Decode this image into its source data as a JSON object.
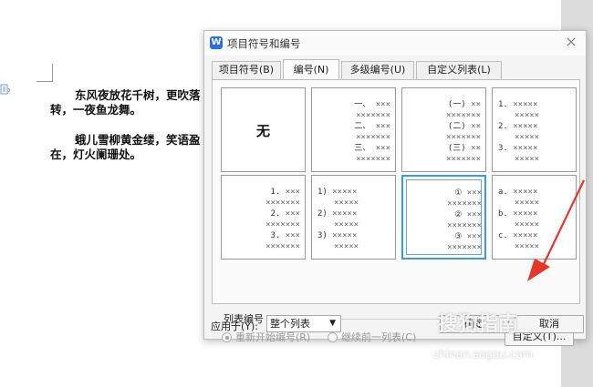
{
  "document": {
    "lines": [
      "东风夜放花千树，更吹落",
      "转，一夜鱼龙舞。",
      "蛾儿雪柳黄金缕，笑语盈",
      "在，灯火阑珊处。"
    ]
  },
  "dialog": {
    "title": "项目符号和编号",
    "tabs": [
      "项目符号(B)",
      "编号(N)",
      "多级编号(U)",
      "自定义列表(L)"
    ],
    "active_tab": "编号(N)",
    "cells": [
      {
        "id": "none",
        "label": "无",
        "rows": []
      },
      {
        "id": "chinese",
        "rows": [
          {
            "num": "一、",
            "text": "×××"
          },
          {
            "num": "",
            "text": "×××××××"
          },
          {
            "num": "二、",
            "text": "×××"
          },
          {
            "num": "",
            "text": "×××××××"
          },
          {
            "num": "三、",
            "text": "×××"
          },
          {
            "num": "",
            "text": "×××××××"
          }
        ]
      },
      {
        "id": "paren-chinese",
        "rows": [
          {
            "num": "(一)",
            "text": "××"
          },
          {
            "num": "",
            "text": "×××××××"
          },
          {
            "num": "(二)",
            "text": "××"
          },
          {
            "num": "",
            "text": "×××××××"
          },
          {
            "num": "(三)",
            "text": "××"
          },
          {
            "num": "",
            "text": "×××××××"
          }
        ]
      },
      {
        "id": "decimal-dot",
        "rows": [
          {
            "num": "1.",
            "text": "×××××"
          },
          {
            "num": "",
            "text": "×××××"
          },
          {
            "num": "2.",
            "text": "×××××"
          },
          {
            "num": "",
            "text": "×××××"
          },
          {
            "num": "3.",
            "text": "×××××"
          },
          {
            "num": "",
            "text": "×××××"
          }
        ]
      },
      {
        "id": "decimal-dot-center",
        "rows": [
          {
            "num": "1.",
            "text": "×××"
          },
          {
            "num": "",
            "text": "×××××××"
          },
          {
            "num": "2.",
            "text": "×××"
          },
          {
            "num": "",
            "text": "×××××××"
          },
          {
            "num": "3.",
            "text": "×××"
          },
          {
            "num": "",
            "text": "×××××××"
          }
        ]
      },
      {
        "id": "decimal-paren",
        "rows": [
          {
            "num": "1)",
            "text": "×××××"
          },
          {
            "num": "",
            "text": "×××××"
          },
          {
            "num": "2)",
            "text": "×××××"
          },
          {
            "num": "",
            "text": "×××××"
          },
          {
            "num": "3)",
            "text": "×××××"
          },
          {
            "num": "",
            "text": "×××××"
          }
        ]
      },
      {
        "id": "circled",
        "rows": [
          {
            "num": "①",
            "text": "×××"
          },
          {
            "num": "",
            "text": "×××××××"
          },
          {
            "num": "②",
            "text": "×××"
          },
          {
            "num": "",
            "text": "×××××××"
          },
          {
            "num": "③",
            "text": "×××"
          },
          {
            "num": "",
            "text": "×××××××"
          }
        ]
      },
      {
        "id": "alpha",
        "rows": [
          {
            "num": "a.",
            "text": "×××××"
          },
          {
            "num": "",
            "text": "×××××"
          },
          {
            "num": "b.",
            "text": "×××××"
          },
          {
            "num": "",
            "text": "×××××"
          },
          {
            "num": "c.",
            "text": "×××××"
          },
          {
            "num": "",
            "text": "×××××"
          }
        ]
      }
    ],
    "selected_cell": "circled",
    "list_numbering_label": "列表编号",
    "radio_restart": "重新开始编号(R)",
    "radio_continue": "继续前一列表(C)",
    "customize_button": "自定义(T)...",
    "apply_to_label": "应用于(Y):",
    "apply_to_value": "整个列表",
    "ok_button": "确定",
    "cancel_button": "取消"
  },
  "watermark": {
    "brand": "搜狗指南",
    "url": "zhinan.sogou.com"
  },
  "colors": {
    "selection": "#3c9ad8",
    "arrow": "#e8352b",
    "title_icon": "#2d6fe0"
  }
}
